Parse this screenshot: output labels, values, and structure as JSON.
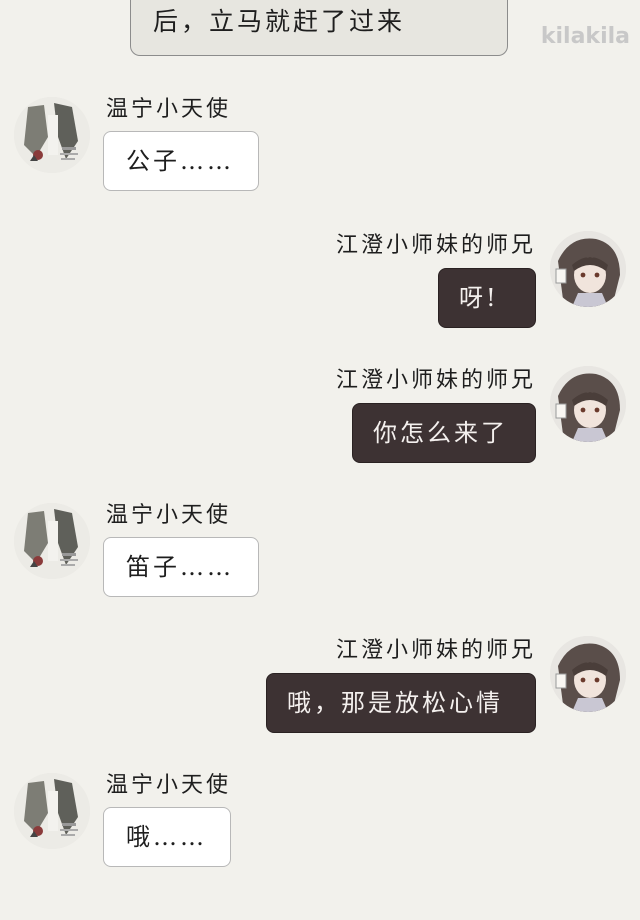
{
  "narration": {
    "text": "后，立马就赶了过来"
  },
  "watermark": {
    "text": "kilakila"
  },
  "messages": [
    {
      "side": "left",
      "sender": "温宁小天使",
      "text": "公子……"
    },
    {
      "side": "right",
      "sender": "江澄小师妹的师兄",
      "text": "呀!"
    },
    {
      "side": "right",
      "sender": "江澄小师妹的师兄",
      "text": "你怎么来了"
    },
    {
      "side": "left",
      "sender": "温宁小天使",
      "text": "笛子……"
    },
    {
      "side": "right",
      "sender": "江澄小师妹的师兄",
      "text": "哦，那是放松心情"
    },
    {
      "side": "left",
      "sender": "温宁小天使",
      "text": "哦……"
    }
  ],
  "colors": {
    "background": "#f2f1ec",
    "white_bubble": "#ffffff",
    "dark_bubble": "#3d3233",
    "text": "#1e1e1e"
  }
}
